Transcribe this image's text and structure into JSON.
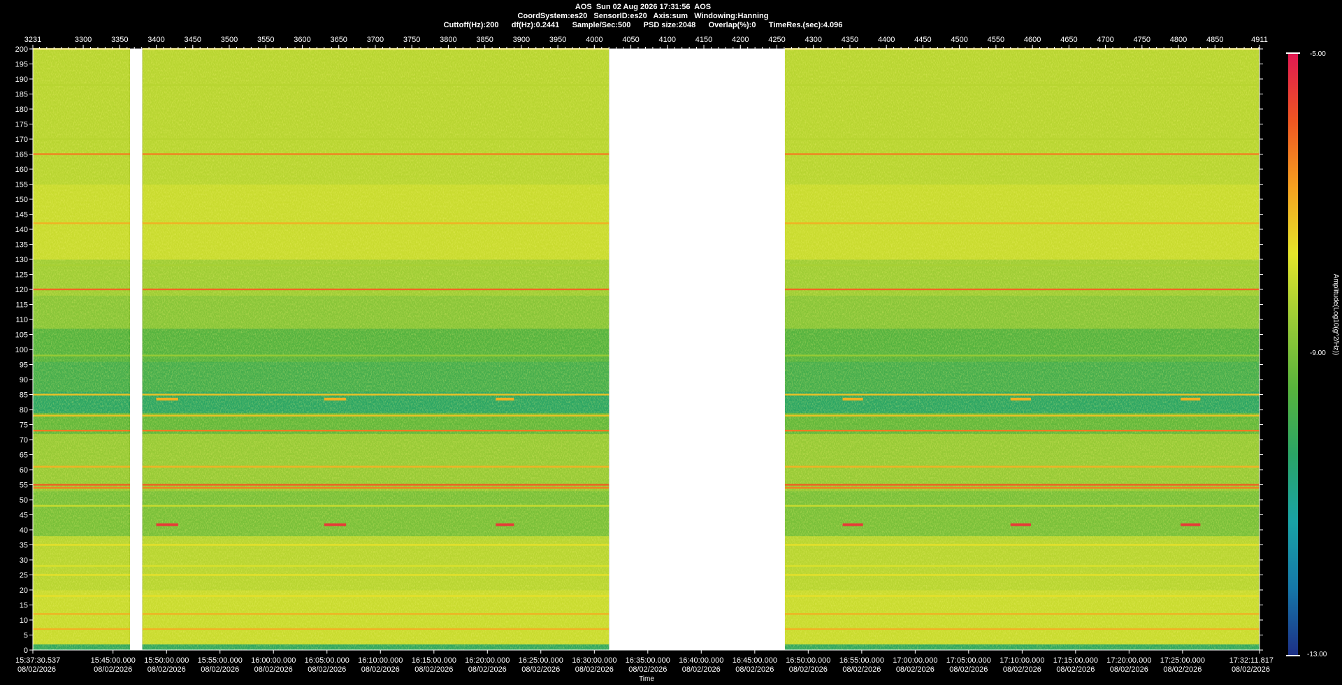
{
  "header": {
    "line1": "AOS  Sun 02 Aug 2026 17:31:56  AOS",
    "line2": "CoordSystem:es20   SensorID:es20   Axis:sum   Windowing:Hanning",
    "line3": "Cuttoff(Hz):200      df(Hz):0.2441      Sample/Sec:500      PSD size:2048      Overlap(%):0      TimeRes.(sec):4.096"
  },
  "colorbar": {
    "title": "Amplitude(Log10(g^2/Hz))",
    "max_label": "-5.00",
    "mid_label": "-9.00",
    "min_label": "-13.00",
    "range": [
      -13,
      -5
    ],
    "colors": [
      "#1d2f86",
      "#1577a8",
      "#19a3a6",
      "#2aa566",
      "#58b43c",
      "#9acb36",
      "#e5e52a",
      "#f5a020",
      "#ee5522",
      "#e01852"
    ]
  },
  "chart_data": {
    "type": "heatmap",
    "title": "",
    "xlabel": "Time",
    "ylabel": "",
    "top_axis": {
      "range": [
        3231,
        4911
      ],
      "ticks": [
        3231,
        3300,
        3350,
        3400,
        3450,
        3500,
        3550,
        3600,
        3650,
        3700,
        3750,
        3800,
        3850,
        3900,
        3950,
        4000,
        4050,
        4100,
        4150,
        4200,
        4250,
        4300,
        4350,
        4400,
        4450,
        4500,
        4550,
        4600,
        4650,
        4700,
        4750,
        4800,
        4850,
        4911
      ]
    },
    "y_range": [
      0,
      200
    ],
    "y_ticks": [
      0,
      5,
      10,
      15,
      20,
      25,
      30,
      35,
      40,
      45,
      50,
      55,
      60,
      65,
      70,
      75,
      80,
      85,
      90,
      95,
      100,
      105,
      110,
      115,
      120,
      125,
      130,
      135,
      140,
      145,
      150,
      155,
      160,
      165,
      170,
      175,
      180,
      185,
      190,
      195,
      200
    ],
    "time_labels": [
      {
        "time": "15:37:30.537",
        "date": "08/02/2026",
        "pos": 3231
      },
      {
        "time": "15:45:00.000",
        "date": "08/02/2026",
        "pos": 3340.8
      },
      {
        "time": "15:50:00.000",
        "date": "08/02/2026",
        "pos": 3414.1
      },
      {
        "time": "15:55:00.000",
        "date": "08/02/2026",
        "pos": 3487.3
      },
      {
        "time": "16:00:00.000",
        "date": "08/02/2026",
        "pos": 3560.5
      },
      {
        "time": "16:05:00.000",
        "date": "08/02/2026",
        "pos": 3633.8
      },
      {
        "time": "16:10:00.000",
        "date": "08/02/2026",
        "pos": 3707.0
      },
      {
        "time": "16:15:00.000",
        "date": "08/02/2026",
        "pos": 3780.3
      },
      {
        "time": "16:20:00.000",
        "date": "08/02/2026",
        "pos": 3853.5
      },
      {
        "time": "16:25:00.000",
        "date": "08/02/2026",
        "pos": 3926.7
      },
      {
        "time": "16:30:00.000",
        "date": "08/02/2026",
        "pos": 4000.0
      },
      {
        "time": "16:35:00.000",
        "date": "08/02/2026",
        "pos": 4073.2
      },
      {
        "time": "16:40:00.000",
        "date": "08/02/2026",
        "pos": 4146.4
      },
      {
        "time": "16:45:00.000",
        "date": "08/02/2026",
        "pos": 4219.7
      },
      {
        "time": "16:50:00.000",
        "date": "08/02/2026",
        "pos": 4292.9
      },
      {
        "time": "16:55:00.000",
        "date": "08/02/2026",
        "pos": 4366.2
      },
      {
        "time": "17:00:00.000",
        "date": "08/02/2026",
        "pos": 4439.4
      },
      {
        "time": "17:05:00.000",
        "date": "08/02/2026",
        "pos": 4512.6
      },
      {
        "time": "17:10:00.000",
        "date": "08/02/2026",
        "pos": 4585.9
      },
      {
        "time": "17:15:00.000",
        "date": "08/02/2026",
        "pos": 4659.1
      },
      {
        "time": "17:20:00.000",
        "date": "08/02/2026",
        "pos": 4732.3
      },
      {
        "time": "17:25:00.000",
        "date": "08/02/2026",
        "pos": 4805.6
      },
      {
        "time": "17:32:11.817",
        "date": "08/02/2026",
        "pos": 4911
      }
    ],
    "data_gaps": [
      [
        3364,
        3381
      ],
      [
        4020,
        4261
      ]
    ],
    "spectral_lines_hz": [
      {
        "hz": 200,
        "level": -7.5
      },
      {
        "hz": 188,
        "level": -8.2
      },
      {
        "hz": 170,
        "level": -8.2
      },
      {
        "hz": 165,
        "level": -6.4
      },
      {
        "hz": 142,
        "level": -7.0
      },
      {
        "hz": 128,
        "level": -8.4
      },
      {
        "hz": 120,
        "level": -6.1
      },
      {
        "hz": 98,
        "level": -8.6
      },
      {
        "hz": 85,
        "level": -7.2
      },
      {
        "hz": 78,
        "level": -7.2
      },
      {
        "hz": 73,
        "level": -6.3
      },
      {
        "hz": 61,
        "level": -7.0
      },
      {
        "hz": 55,
        "level": -6.0
      },
      {
        "hz": 54,
        "level": -6.4
      },
      {
        "hz": 48,
        "level": -8.0
      },
      {
        "hz": 35,
        "level": -7.6
      },
      {
        "hz": 28,
        "level": -7.8
      },
      {
        "hz": 25,
        "level": -7.6
      },
      {
        "hz": 18,
        "level": -7.6
      },
      {
        "hz": 12,
        "level": -7.0
      },
      {
        "hz": 7,
        "level": -7.0
      }
    ],
    "events": [
      {
        "x0": 3400,
        "x1": 3430,
        "hz": 83.5,
        "level": -7.0
      },
      {
        "x0": 3400,
        "x1": 3430,
        "hz": 41.7,
        "level": -5.5
      },
      {
        "x0": 3630,
        "x1": 3660,
        "hz": 83.5,
        "level": -7.0
      },
      {
        "x0": 3630,
        "x1": 3660,
        "hz": 41.7,
        "level": -5.5
      },
      {
        "x0": 3865,
        "x1": 3890,
        "hz": 83.5,
        "level": -7.0
      },
      {
        "x0": 3865,
        "x1": 3890,
        "hz": 41.7,
        "level": -5.5
      },
      {
        "x0": 4340,
        "x1": 4368,
        "hz": 83.5,
        "level": -7.0
      },
      {
        "x0": 4340,
        "x1": 4368,
        "hz": 41.7,
        "level": -5.5
      },
      {
        "x0": 4570,
        "x1": 4598,
        "hz": 83.5,
        "level": -7.0
      },
      {
        "x0": 4570,
        "x1": 4598,
        "hz": 41.7,
        "level": -5.5
      },
      {
        "x0": 4803,
        "x1": 4830,
        "hz": 83.5,
        "level": -7.0
      },
      {
        "x0": 4803,
        "x1": 4830,
        "hz": 41.7,
        "level": -5.5
      }
    ],
    "grid": false,
    "legend": "colorbar-right"
  }
}
